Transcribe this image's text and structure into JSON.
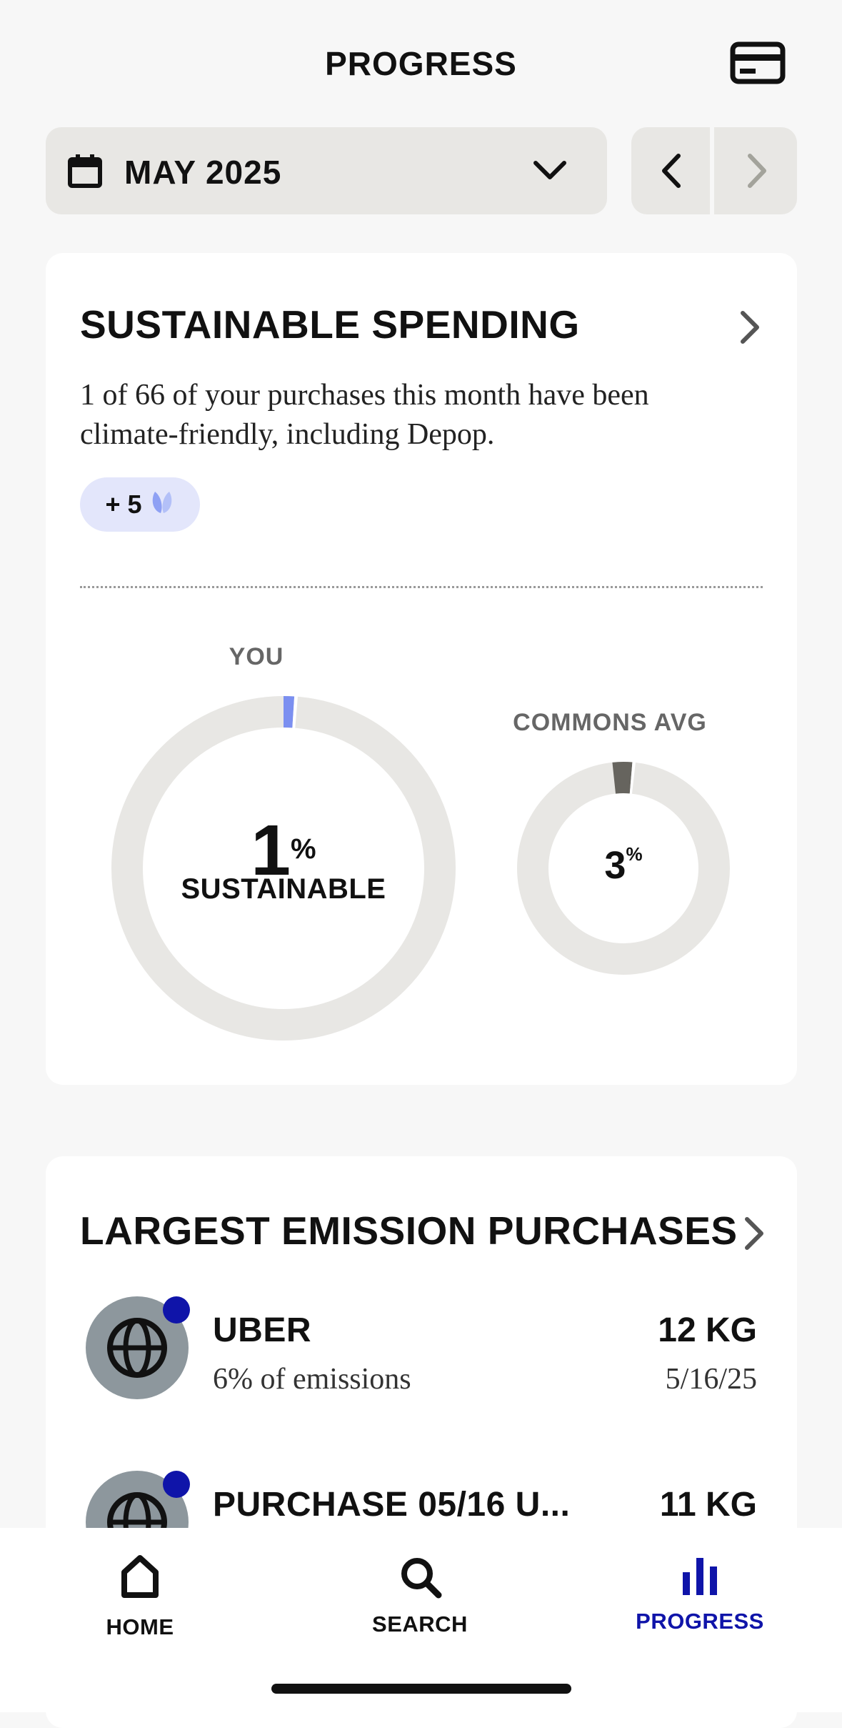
{
  "header": {
    "title": "PROGRESS"
  },
  "month_selector": {
    "label": "MAY 2025"
  },
  "sustainable": {
    "title": "SUSTAINABLE SPENDING",
    "description_line1": "1 of 66 of your purchases this month have been",
    "description_line2": "climate-friendly, including Depop.",
    "pill_value": "+ 5",
    "you_label": "YOU",
    "you_pct": "1",
    "pct_sign": "%",
    "sustainable_label": "SUSTAINABLE",
    "avg_label": "COMMONS AVG",
    "avg_pct": "3",
    "you_fraction": 0.01,
    "avg_fraction": 0.03,
    "colors": {
      "you_arc": "#7b8ff0",
      "avg_arc": "#66645e",
      "track": "#e8e7e4"
    }
  },
  "emissions": {
    "title": "LARGEST EMISSION PURCHASES",
    "items": [
      {
        "name": "UBER",
        "sub": "6% of emissions",
        "kg": "12 KG",
        "date": "5/16/25"
      },
      {
        "name": "PURCHASE 05/16 U...",
        "kg": "11 KG"
      }
    ]
  },
  "tabs": [
    {
      "label": "HOME"
    },
    {
      "label": "SEARCH"
    },
    {
      "label": "PROGRESS"
    }
  ],
  "colors": {
    "accent": "#0f14a9",
    "card_bg": "#ffffff",
    "page_bg": "#f7f7f7"
  }
}
